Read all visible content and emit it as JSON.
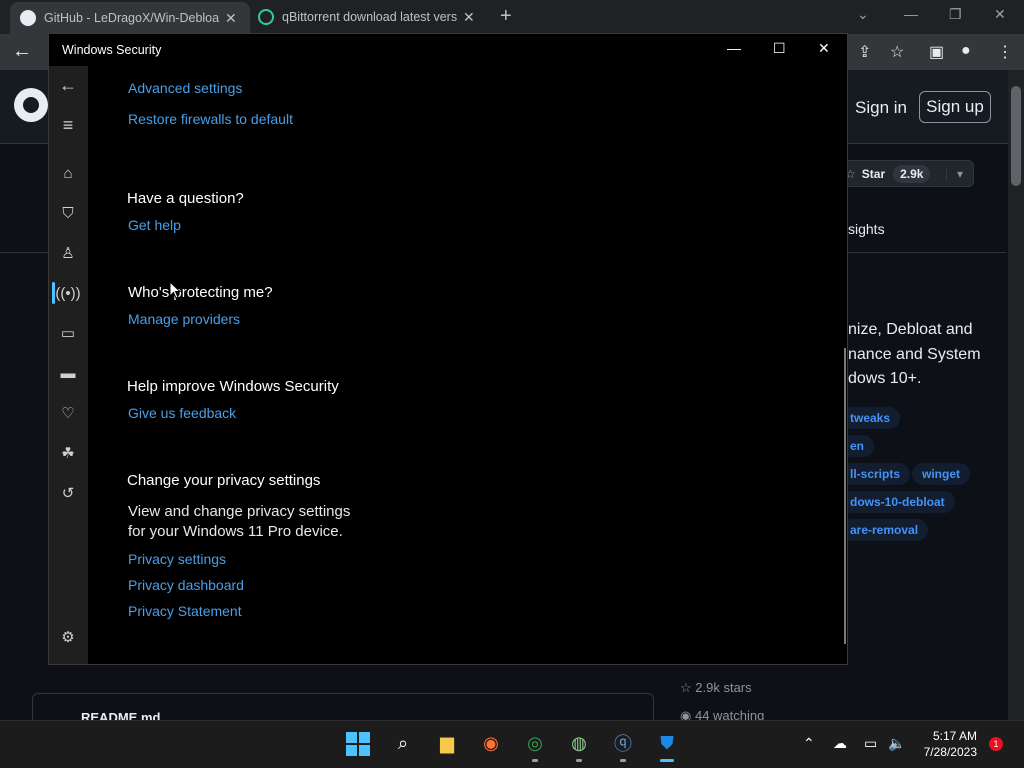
{
  "browser": {
    "tabs": [
      {
        "label": "GitHub - LeDragoX/Win-Debloat"
      },
      {
        "label": "qBittorrent download latest versi"
      }
    ]
  },
  "github": {
    "sign_in": "Sign in",
    "sign_up": "Sign up",
    "star_label": "Star",
    "star_count": "2.9k",
    "insights_tab": "sights",
    "about_lines": [
      "nize, Debloat and",
      "nance and System",
      "dows 10+."
    ],
    "topics": [
      "tweaks",
      "en",
      "ll-scripts",
      "winget",
      "dows-10-debloat",
      "are-removal"
    ],
    "stars_stat": "2.9k stars",
    "watching_stat": "44 watching",
    "readme": "README.md"
  },
  "window": {
    "title": "Windows Security"
  },
  "content": {
    "advanced_settings": "Advanced settings",
    "restore_firewalls": "Restore firewalls to default",
    "question_heading": "Have a question?",
    "get_help": "Get help",
    "protecting_heading": "Who's protecting me?",
    "manage_providers": "Manage providers",
    "improve_heading": "Help improve Windows Security",
    "give_feedback": "Give us feedback",
    "privacy_heading": "Change your privacy settings",
    "privacy_text": "View and change privacy settings for your Windows 11 Pro device.",
    "privacy_settings": "Privacy settings",
    "privacy_dashboard": "Privacy dashboard",
    "privacy_statement": "Privacy Statement"
  },
  "nav": {
    "items": [
      "back-icon",
      "menu-icon",
      "home-icon",
      "shield-icon",
      "account-icon",
      "firewall-network-icon",
      "app-browser-icon",
      "device-security-icon",
      "device-health-icon",
      "family-icon",
      "history-icon",
      "settings-icon"
    ],
    "active_accent": "#4cc2ff"
  },
  "taskbar": {
    "time": "5:17 AM",
    "date": "7/28/2023",
    "notification_count": "1"
  }
}
